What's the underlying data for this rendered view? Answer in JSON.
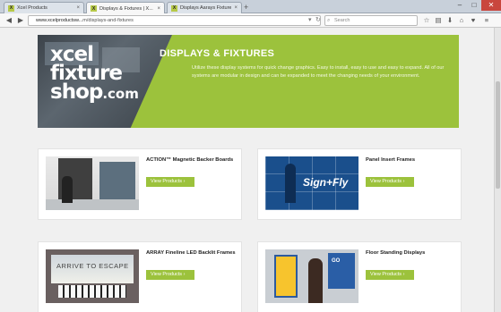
{
  "browser": {
    "tabs": [
      {
        "label": "Xcel Products",
        "favicon": "X",
        "active": false
      },
      {
        "label": "Displays &amp; Fixtures | X...",
        "favicon": "X",
        "active": true
      },
      {
        "label": "Displays Aarays Fixtures | X...",
        "favicon": "X",
        "active": false
      }
    ],
    "url_host": "www.xcelproductsw...",
    "url_path": "m/displays-and-fixtures",
    "search_placeholder": "Search"
  },
  "hero": {
    "logo_line1": "xcel",
    "logo_line2": "fixture",
    "logo_line3": "shop",
    "logo_suffix": ".com",
    "title": "DISPLAYS & FIXTURES",
    "description": "Utilize these display systems for quick change graphics. Easy to install, easy to use and easy to expand. All of our systems are modular in design and can be expanded to meet the changing needs of your environment."
  },
  "products": [
    {
      "name": "ACTION™ Magnetic Backer Boards",
      "button": "View Products  ›"
    },
    {
      "name": "Panel Insert Frames",
      "button": "View Products  ›",
      "thumb_text": "Sign+Fly"
    },
    {
      "name": "ARRAY Fineline LED Backlit Frames",
      "button": "View Products  ›",
      "thumb_text": "ARRIVE TO ESCAPE"
    },
    {
      "name": "Floor Standing Displays",
      "button": "View Products  ›",
      "thumb_text": "GO"
    }
  ],
  "colors": {
    "accent": "#9cc23c"
  }
}
